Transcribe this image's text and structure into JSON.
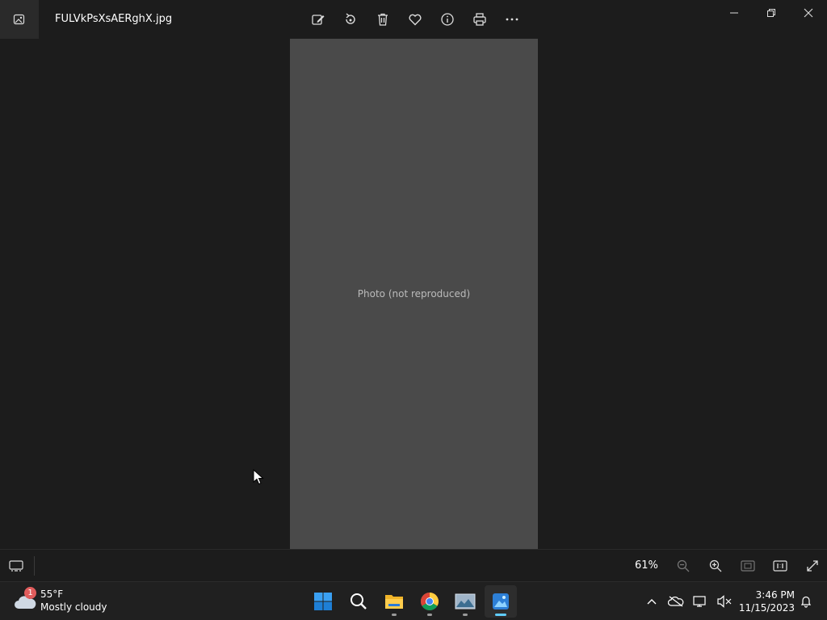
{
  "titlebar": {
    "file_name": "FULVkPsXsAERghX.jpg"
  },
  "toolbar": {
    "buttons": [
      "edit-image-icon",
      "rotate-icon",
      "delete-icon",
      "favorite-icon",
      "info-icon",
      "print-icon",
      "more-icon"
    ]
  },
  "window_controls": [
    "minimize-icon",
    "restore-icon",
    "close-icon"
  ],
  "viewer": {
    "placeholder_label": "Photo (not reproduced)"
  },
  "bottombar": {
    "zoom_level": "61%"
  },
  "taskbar": {
    "weather": {
      "badge": "1",
      "temperature": "55°F",
      "description": "Mostly cloudy"
    },
    "apps": [
      "start-icon",
      "search-icon",
      "file-explorer-icon",
      "chrome-icon",
      "photos-legacy-icon",
      "photos-icon"
    ],
    "clock": {
      "time": "3:46 PM",
      "date": "11/15/2023"
    }
  },
  "colors": {
    "background": "#1c1c1c",
    "taskbar": "#202020",
    "accent": "#60cdff"
  }
}
